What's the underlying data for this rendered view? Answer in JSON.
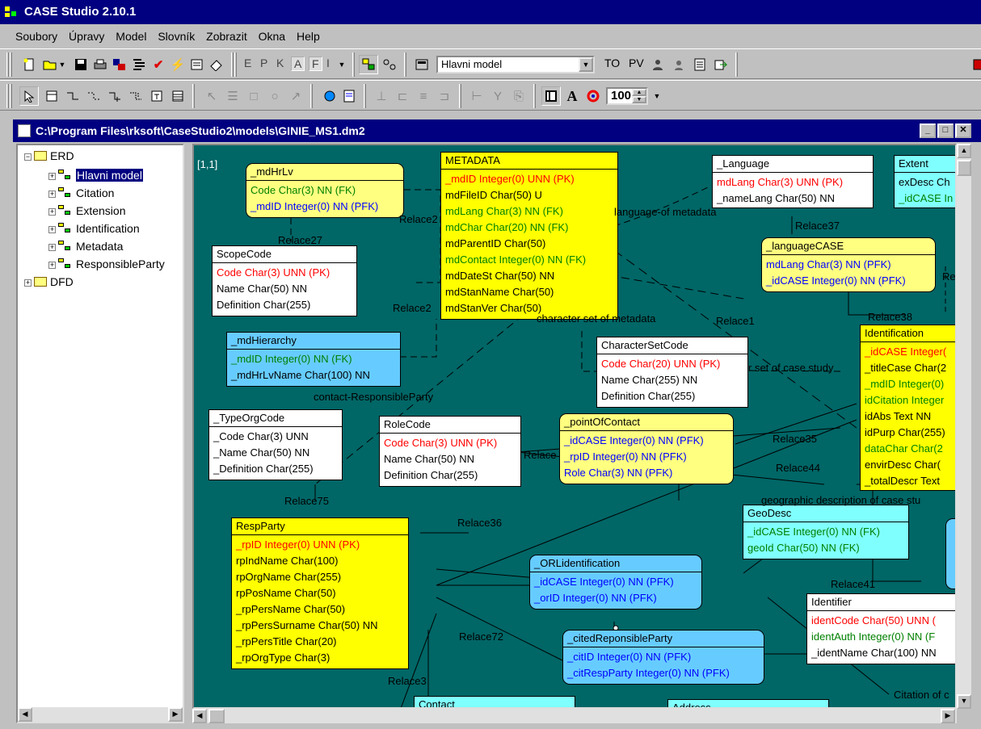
{
  "app": {
    "title": "CASE Studio 2.10.1"
  },
  "menu": [
    "Soubory",
    "Úpravy",
    "Model",
    "Slovník",
    "Zobrazit",
    "Okna",
    "Help"
  ],
  "toolbar1": {
    "letters": [
      "E",
      "P",
      "K",
      "A",
      "F",
      "I"
    ],
    "model_combo": "Hlavni model",
    "to_label": "TO",
    "pv_label": "PV"
  },
  "toolbar2": {
    "zoom": "100"
  },
  "document": {
    "title": "C:\\Program Files\\rksoft\\CaseStudio2\\models\\GINIE_MS1.dm2"
  },
  "tree": {
    "root_erd": "ERD",
    "items": [
      "Hlavni model",
      "Citation",
      "Extension",
      "Identification",
      "Metadata",
      "ResponsibleParty"
    ],
    "root_dfd": "DFD"
  },
  "canvas": {
    "page_marker": "[1,1]",
    "entities": {
      "mdHrLv": {
        "name": "_mdHrLv",
        "f1": "Code Char(3) NN (FK)",
        "f2": "_mdID Integer(0) NN (PFK)"
      },
      "metadata": {
        "name": "METADATA",
        "f1": "_mdID Integer(0) UNN (PK)",
        "f2": "mdFileID Char(50) U",
        "f3": "mdLang Char(3) NN (FK)",
        "f4": "mdChar Char(20) NN (FK)",
        "f5": "mdParentID Char(50)",
        "f6": "mdContact Integer(0) NN (FK)",
        "f7": "mdDateSt Char(50) NN",
        "f8": "mdStanName Char(50)",
        "f9": "mdStanVer Char(50)"
      },
      "language": {
        "name": "_Language",
        "f1": "mdLang Char(3) UNN (PK)",
        "f2": "_nameLang Char(50) NN"
      },
      "extent": {
        "name": "Extent",
        "f1": "exDesc Ch",
        "f2": "_idCASE In"
      },
      "scopecode": {
        "name": "ScopeCode",
        "f1": "Code Char(3) UNN (PK)",
        "f2": "Name Char(50) NN",
        "f3": "Definition Char(255)"
      },
      "languagecase": {
        "name": "_languageCASE",
        "f1": "mdLang Char(3) NN (PFK)",
        "f2": "_idCASE Integer(0) NN (PFK)"
      },
      "mdhierarchy": {
        "name": "_mdHierarchy",
        "f1": "_mdID Integer(0) NN (FK)",
        "f2": "_mdHrLvName Char(100) NN"
      },
      "charsetcode": {
        "name": "CharacterSetCode",
        "f1": "Code Char(20) UNN (PK)",
        "f2": "Name Char(255) NN",
        "f3": "Definition Char(255)"
      },
      "identification": {
        "name": "Identification",
        "f1": "_idCASE Integer(",
        "f2": "_titleCase Char(2",
        "f3": "_mdID Integer(0)",
        "f4": "idCitation Integer",
        "f5": "idAbs Text NN",
        "f6": "idPurp Char(255)",
        "f7": "dataChar Char(2",
        "f8": "envirDesc Char(",
        "f9": "_totalDescr Text"
      },
      "typeorgcode": {
        "name": "_TypeOrgCode",
        "f1": "_Code Char(3) UNN",
        "f2": "_Name Char(50) NN",
        "f3": "_Definition Char(255)"
      },
      "rolecode": {
        "name": "RoleCode",
        "f1": "Code Char(3) UNN (PK)",
        "f2": "Name Char(50) NN",
        "f3": "Definition Char(255)"
      },
      "pointofcontact": {
        "name": "_pointOfContact",
        "f1": "_idCASE Integer(0) NN (PFK)",
        "f2": "_rpID Integer(0) NN (PFK)",
        "f3": "Role Char(3) NN (PFK)"
      },
      "respparty": {
        "name": "RespParty",
        "f1": "_rpID Integer(0) UNN (PK)",
        "f2": "rpIndName Char(100)",
        "f3": "rpOrgName Char(255)",
        "f4": "rpPosName Char(50)",
        "f5": "_rpPersName Char(50)",
        "f6": "_rpPersSurname Char(50) NN",
        "f7": "_rpPersTitle Char(20)",
        "f8": "_rpOrgType Char(3)"
      },
      "geodesc": {
        "name": "GeoDesc",
        "f1": "_idCASE Integer(0) NN (FK)",
        "f2": "geoId Char(50) NN (FK)"
      },
      "orlidentification": {
        "name": "_ORLidentification",
        "f1": "_idCASE Integer(0) NN (PFK)",
        "f2": "_orID Integer(0) NN (PFK)"
      },
      "identifier": {
        "name": "Identifier",
        "f1": "identCode Char(50) UNN (",
        "f2": "identAuth Integer(0) NN (F",
        "f3": "_identName Char(100) NN"
      },
      "citedresp": {
        "name": "_citedReponsibleParty",
        "f1": "_citID Integer(0) NN (PFK)",
        "f2": "_citRespParty Integer(0) NN (PFK)"
      },
      "contact": {
        "name": "Contact"
      },
      "address": {
        "name": "Address"
      }
    },
    "relations": {
      "r_relace2": "Relace2",
      "r_language": "language-of metadata",
      "r_relace27": "Relace27",
      "r_relace37": "Relace37",
      "r_relace2b": "Relace2",
      "r_charset": "character set of metadata",
      "r_relace1": "Relace1",
      "r_relace38": "Relace38",
      "r_rel_right": "Rel",
      "r_charcase": "r set of case study",
      "r_contact": "contact-ResponsibleParty",
      "r_relace35": "Relace35",
      "r_relace44": "Relace44",
      "r_relace": "Relace",
      "r_relace75": "Relace75",
      "r_geographic": "geographic description of case stu",
      "r_relace36": "Relace36",
      "r_relace41": "Relace41",
      "r_relace72": "Relace72",
      "r_relace3": "Relace3",
      "r_citation": "Citation of c"
    }
  }
}
